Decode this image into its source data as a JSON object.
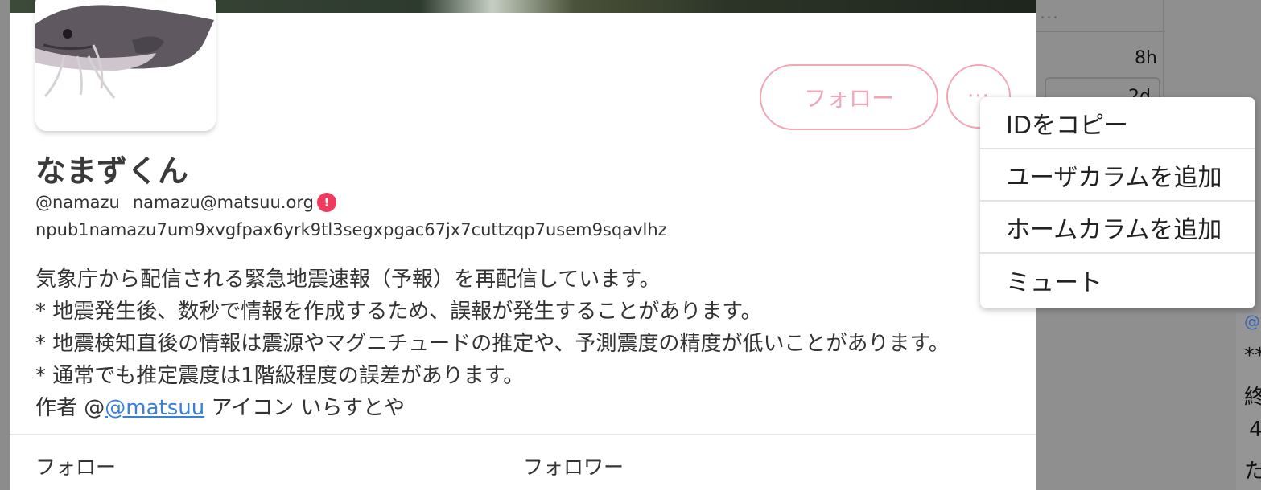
{
  "background": {
    "ellipsis": "...",
    "times": [
      "8h",
      "2d"
    ],
    "side_text": [
      "@",
      "**",
      "終",
      "4",
      "た"
    ]
  },
  "profile": {
    "display_name": "なまずくん",
    "handle": "@namazu",
    "nip05": "namazu@matsuu.org",
    "nip05_warning": "!",
    "npub": "npub1namazu7um9xvgfpax6yrk9tl3segxpgac67jx7cuttzqp7usem9sqavlhz",
    "follow_label": "フォロー",
    "more_label": "···",
    "bio": {
      "line1": "気象庁から配信される緊急地震速報（予報）を再配信しています。",
      "line2": "* 地震発生後、数秒で情報を作成するため、誤報が発生することがあります。",
      "line3": "* 地震検知直後の情報は震源やマグニチュードの推定や、予測震度の精度が低いことがあります。",
      "line4": "* 通常でも推定震度は1階級程度の誤差があります。",
      "line5_prefix": "作者 @",
      "line5_link": "@matsuu",
      "line5_suffix": " アイコン いらすとや"
    },
    "stats": {
      "following_label": "フォロー",
      "followers_label": "フォロワー"
    }
  },
  "menu": {
    "items": [
      "IDをコピー",
      "ユーザカラムを追加",
      "ホームカラムを追加",
      "ミュート"
    ]
  },
  "colors": {
    "accent": "#f3a6b6",
    "warning": "#ef3a5d",
    "link": "#3b7fd6"
  }
}
